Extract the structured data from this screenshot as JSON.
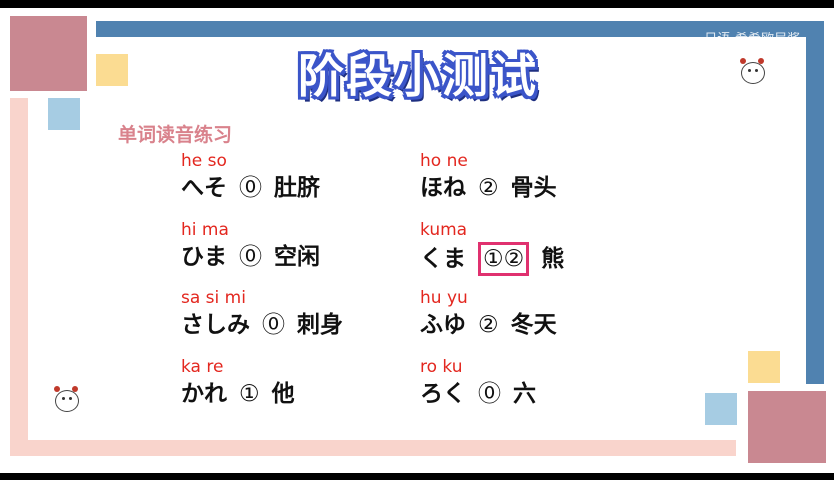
{
  "header": {
    "title": "阶段小测试",
    "watermark": "日语-希希欧尼酱",
    "logo": "bilibili"
  },
  "section_title": "单词读音练习",
  "words": [
    {
      "romaji": "he so",
      "kana": "へそ",
      "tone": "⓪",
      "meaning": "肚脐"
    },
    {
      "romaji": "ho ne",
      "kana": "ほね",
      "tone": "②",
      "meaning": "骨头"
    },
    {
      "romaji": "hi ma",
      "kana": "ひま",
      "tone": "⓪",
      "meaning": "空闲"
    },
    {
      "romaji": "kuma",
      "kana": "くま",
      "tone": "①②",
      "meaning": "熊"
    },
    {
      "romaji": "sa si mi",
      "kana": "さしみ",
      "tone": "⓪",
      "meaning": "刺身"
    },
    {
      "romaji": "hu yu",
      "kana": "ふゆ",
      "tone": "②",
      "meaning": "冬天"
    },
    {
      "romaji": "ka re",
      "kana": "かれ",
      "tone": "①",
      "meaning": "他"
    },
    {
      "romaji": "ro ku",
      "kana": "ろく",
      "tone": "⓪",
      "meaning": "六"
    }
  ],
  "colors": {
    "pink_block": "#c98891",
    "yellow_block": "#fbdc92",
    "blue_block": "#a6cce3",
    "dark_blue_bar": "#5082b0",
    "peach_bar": "#f9d4cc",
    "romaji_red": "#e3271f",
    "highlight_box": "#e0316f"
  }
}
